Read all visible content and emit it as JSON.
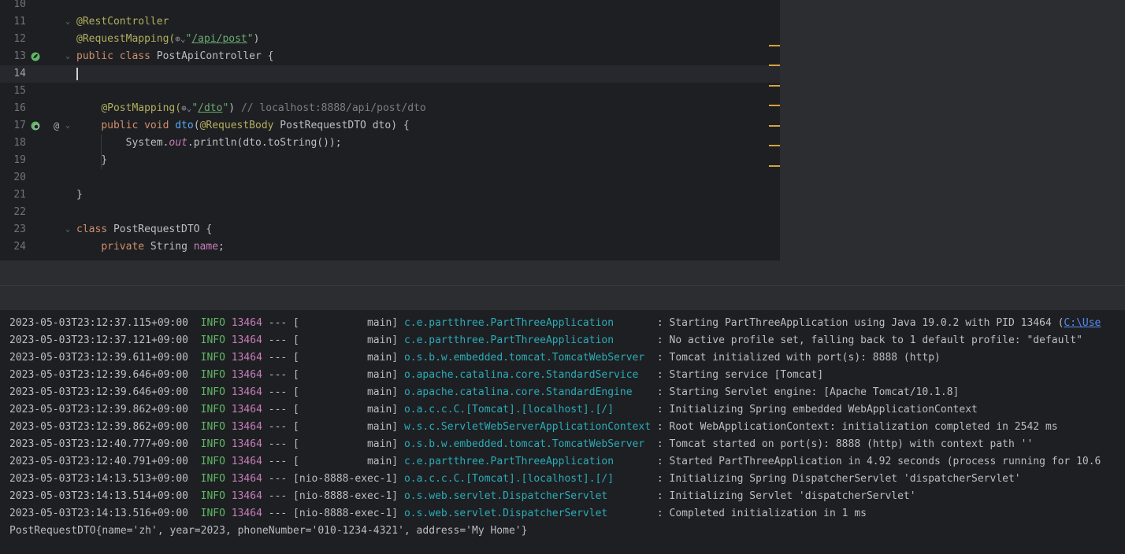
{
  "editor": {
    "line_numbers": [
      "10",
      "11",
      "12",
      "13",
      "14",
      "15",
      "16",
      "17",
      "18",
      "19",
      "20",
      "21",
      "22",
      "23",
      "24"
    ],
    "code": {
      "l11_annotation": "@RestController",
      "l12_annotation": "@RequestMapping(",
      "l12_globe": "⊕⌄",
      "l12_path": "/api/post",
      "l12_close": ")",
      "l13_public": "public",
      "l13_class": "class",
      "l13_name": "PostApiController {",
      "l16_annotation": "@PostMapping(",
      "l16_globe": "⊕⌄",
      "l16_path": "/dto",
      "l16_close": ")",
      "l16_comment": "// localhost:8888/api/post/dto",
      "l17_public": "public",
      "l17_void": "void",
      "l17_method": "dto",
      "l17_open": "(",
      "l17_annotation": "@RequestBody",
      "l17_rest": " PostRequestDTO dto) {",
      "l18_system": "System.",
      "l18_out": "out",
      "l18_rest": ".println(dto.toString());",
      "l19_brace": "}",
      "l21_brace": "}",
      "l23_class": "class",
      "l23_rest": " PostRequestDTO {",
      "l24_private": "private",
      "l24_type": " String ",
      "l24_field": "name",
      "l24_semi": ";"
    }
  },
  "console": {
    "rows": [
      {
        "ts": "2023-05-03T23:12:37.115+09:00",
        "level": "INFO",
        "pid": "13464",
        "thread": "--- [           main]",
        "logger": "c.e.partthree.PartThreeApplication      ",
        "msg": ": Starting PartThreeApplication using Java 19.0.2 with PID 13464 (",
        "link": "C:\\Use"
      },
      {
        "ts": "2023-05-03T23:12:37.121+09:00",
        "level": "INFO",
        "pid": "13464",
        "thread": "--- [           main]",
        "logger": "c.e.partthree.PartThreeApplication      ",
        "msg": ": No active profile set, falling back to 1 default profile: \"default\"",
        "link": ""
      },
      {
        "ts": "2023-05-03T23:12:39.611+09:00",
        "level": "INFO",
        "pid": "13464",
        "thread": "--- [           main]",
        "logger": "o.s.b.w.embedded.tomcat.TomcatWebServer ",
        "msg": ": Tomcat initialized with port(s): 8888 (http)",
        "link": ""
      },
      {
        "ts": "2023-05-03T23:12:39.646+09:00",
        "level": "INFO",
        "pid": "13464",
        "thread": "--- [           main]",
        "logger": "o.apache.catalina.core.StandardService  ",
        "msg": ": Starting service [Tomcat]",
        "link": ""
      },
      {
        "ts": "2023-05-03T23:12:39.646+09:00",
        "level": "INFO",
        "pid": "13464",
        "thread": "--- [           main]",
        "logger": "o.apache.catalina.core.StandardEngine   ",
        "msg": ": Starting Servlet engine: [Apache Tomcat/10.1.8]",
        "link": ""
      },
      {
        "ts": "2023-05-03T23:12:39.862+09:00",
        "level": "INFO",
        "pid": "13464",
        "thread": "--- [           main]",
        "logger": "o.a.c.c.C.[Tomcat].[localhost].[/]      ",
        "msg": ": Initializing Spring embedded WebApplicationContext",
        "link": ""
      },
      {
        "ts": "2023-05-03T23:12:39.862+09:00",
        "level": "INFO",
        "pid": "13464",
        "thread": "--- [           main]",
        "logger": "w.s.c.ServletWebServerApplicationContext",
        "msg": ": Root WebApplicationContext: initialization completed in 2542 ms",
        "link": ""
      },
      {
        "ts": "2023-05-03T23:12:40.777+09:00",
        "level": "INFO",
        "pid": "13464",
        "thread": "--- [           main]",
        "logger": "o.s.b.w.embedded.tomcat.TomcatWebServer ",
        "msg": ": Tomcat started on port(s): 8888 (http) with context path ''",
        "link": ""
      },
      {
        "ts": "2023-05-03T23:12:40.791+09:00",
        "level": "INFO",
        "pid": "13464",
        "thread": "--- [           main]",
        "logger": "c.e.partthree.PartThreeApplication      ",
        "msg": ": Started PartThreeApplication in 4.92 seconds (process running for 10.6",
        "link": ""
      },
      {
        "ts": "2023-05-03T23:14:13.513+09:00",
        "level": "INFO",
        "pid": "13464",
        "thread": "--- [nio-8888-exec-1]",
        "logger": "o.a.c.c.C.[Tomcat].[localhost].[/]      ",
        "msg": ": Initializing Spring DispatcherServlet 'dispatcherServlet'",
        "link": ""
      },
      {
        "ts": "2023-05-03T23:14:13.514+09:00",
        "level": "INFO",
        "pid": "13464",
        "thread": "--- [nio-8888-exec-1]",
        "logger": "o.s.web.servlet.DispatcherServlet       ",
        "msg": ": Initializing Servlet 'dispatcherServlet'",
        "link": ""
      },
      {
        "ts": "2023-05-03T23:14:13.516+09:00",
        "level": "INFO",
        "pid": "13464",
        "thread": "--- [nio-8888-exec-1]",
        "logger": "o.s.web.servlet.DispatcherServlet       ",
        "msg": ": Completed initialization in 1 ms",
        "link": ""
      }
    ],
    "output_line": "PostRequestDTO{name='zh', year=2023, phoneNumber='010-1234-4321', address='My Home'}"
  },
  "colors": {
    "background": "#1e1f22",
    "keyword": "#cf8e6d",
    "annotation": "#b3ae60",
    "string": "#6aab73",
    "info": "#5fb865",
    "pid": "#c77dbb",
    "logger": "#2aacb8",
    "link": "#548af7",
    "warning_stripe": "#d6a33e"
  },
  "icons": [
    "spring-bean-icon",
    "spring-endpoint-icon",
    "at-sign-icon",
    "fold-arrow-icon",
    "globe-icon"
  ]
}
